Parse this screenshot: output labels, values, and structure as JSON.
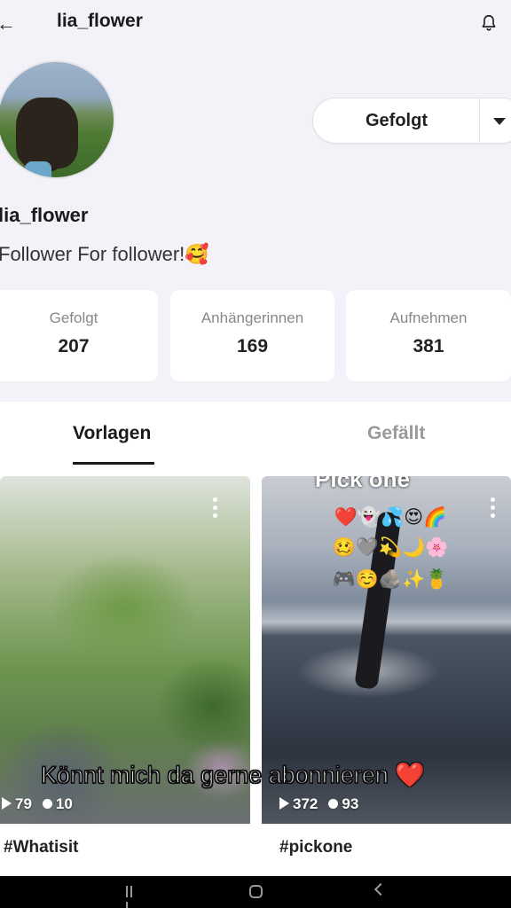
{
  "header": {
    "back_icon": "arrow-left-icon",
    "title": "lia_flower",
    "bell_icon": "bell-icon"
  },
  "profile": {
    "username": "lia_flower",
    "bio": "Follower For follower!🥰",
    "follow_button": {
      "label": "Gefolgt",
      "menu_icon": "caret-down-icon"
    }
  },
  "stats": [
    {
      "label": "Gefolgt",
      "value": "207"
    },
    {
      "label": "Anhängerinnen",
      "value": "169"
    },
    {
      "label": "Aufnehmen",
      "value": "381"
    }
  ],
  "tabs": [
    {
      "label": "Vorlagen",
      "active": true
    },
    {
      "label": "Gefällt",
      "active": false
    }
  ],
  "videos": [
    {
      "plays": "79",
      "comments": "10",
      "caption": "#Whatisit"
    },
    {
      "plays": "372",
      "comments": "93",
      "caption": "#pickone",
      "thumb_text": "Pick one",
      "emoji_rows": [
        "❤️👻💦😍🌈",
        "🥴🩶💫🌙🌸",
        "🎮☺️🪨✨🍍"
      ]
    }
  ],
  "overlay_text": "Könnt mich da gerne abonnieren ❤️",
  "system_nav": {
    "recents_icon": "recents-icon",
    "home_icon": "home-icon",
    "back_icon": "back-icon"
  },
  "colors": {
    "background": "#f3f2f9",
    "text": "#1a1a1a",
    "muted": "#888888",
    "card": "#ffffff",
    "navbar": "#000000"
  }
}
